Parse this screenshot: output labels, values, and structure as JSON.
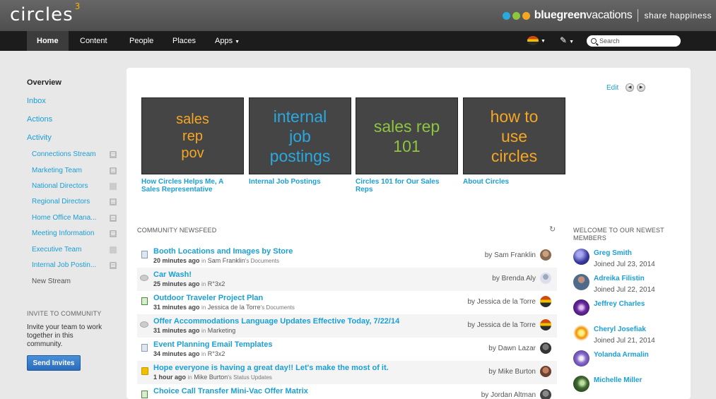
{
  "brand": {
    "app_name": "circles",
    "app_version": "3",
    "company_bold": "bluegreen",
    "company_light": "vacations",
    "tagline": "share happiness",
    "dot_colors": [
      "#2aa8e0",
      "#8cc63f",
      "#f5a623"
    ]
  },
  "nav": {
    "items": [
      {
        "label": "Home",
        "active": true
      },
      {
        "label": "Content"
      },
      {
        "label": "People"
      },
      {
        "label": "Places"
      },
      {
        "label": "Apps"
      }
    ],
    "search_placeholder": "Search"
  },
  "sidebar": {
    "overview": "Overview",
    "inbox": "Inbox",
    "actions": "Actions",
    "activity": "Activity",
    "streams": [
      "Connections Stream",
      "Marketing Team",
      "National Directors",
      "Regional Directors",
      "Home Office Mana...",
      "Meeting Information",
      "Executive Team",
      "Internal Job Postin...",
      "New Stream"
    ],
    "invite_heading": "INVITE TO COMMUNITY",
    "invite_text": "Invite your team to work together in this community.",
    "invite_button": "Send Invites"
  },
  "main": {
    "edit_label": "Edit",
    "tiles": [
      {
        "text": "sales\nrep\npov",
        "color": "#f5a623",
        "caption": "How Circles Helps Me, A Sales Representative"
      },
      {
        "text": "internal\njob\npostings",
        "color": "#2aa8e0",
        "caption": "Internal Job Postings"
      },
      {
        "text": "sales rep\n101",
        "color": "#8cc63f",
        "caption": "Circles 101 for Our Sales Reps"
      },
      {
        "text": "how to\nuse\ncircles",
        "color": "#f5a623",
        "caption": "About Circles"
      }
    ],
    "newsfeed_heading": "COMMUNITY NEWSFEED",
    "newsfeed": [
      {
        "title": "Booth Locations and Images by Store",
        "time": "20 minutes ago",
        "in": "in",
        "place": "Sam Franklin",
        "suffix": "'s Documents",
        "by": "by Sam Franklin",
        "icon": "doc"
      },
      {
        "title": "Car Wash!",
        "time": "25 minutes ago",
        "in": "in",
        "place": "R°3x2",
        "suffix": "",
        "by": "by Brenda Aly",
        "icon": "bubble"
      },
      {
        "title": "Outdoor Traveler Project Plan",
        "time": "31 minutes ago",
        "in": "in",
        "place": "Jessica de la Torre",
        "suffix": "'s Documents",
        "by": "by Jessica de la Torre",
        "icon": "excel"
      },
      {
        "title": "Offer Accommodations Language Updates Effective Today, 7/22/14",
        "time": "31 minutes ago",
        "in": "in",
        "place": "Marketing",
        "suffix": "",
        "by": "by Jessica de la Torre",
        "icon": "bubble"
      },
      {
        "title": "Event Planning Email Templates",
        "time": "34 minutes ago",
        "in": "in",
        "place": "R°3x2",
        "suffix": "",
        "by": "by Dawn Lazar",
        "icon": "doc"
      },
      {
        "title": "Hope everyone is having a great day!!  Let's make the most of it.",
        "time": "1 hour ago",
        "in": "in",
        "place": "Mike Burton",
        "suffix": "'s Status Updates",
        "by": "by Mike Burton",
        "icon": "status"
      },
      {
        "title": "Choice Call Transfer Mini-Vac Offer Matrix",
        "time": "",
        "in": "",
        "place": "",
        "suffix": "",
        "by": "by Jordan Altman",
        "icon": "excel"
      }
    ],
    "welcome_heading": "WELCOME TO OUR NEWEST MEMBERS",
    "members": [
      {
        "name": "Greg Smith",
        "joined": "Joined Jul 23, 2014"
      },
      {
        "name": "Adreika Filistin",
        "joined": "Joined Jul 22, 2014"
      },
      {
        "name": "Jeffrey Charles",
        "joined": ""
      },
      {
        "name": "Cheryl Josefiak",
        "joined": "Joined Jul 21, 2014"
      },
      {
        "name": "Yolanda Armalin",
        "joined": ""
      },
      {
        "name": "Michelle Miller",
        "joined": ""
      }
    ]
  }
}
